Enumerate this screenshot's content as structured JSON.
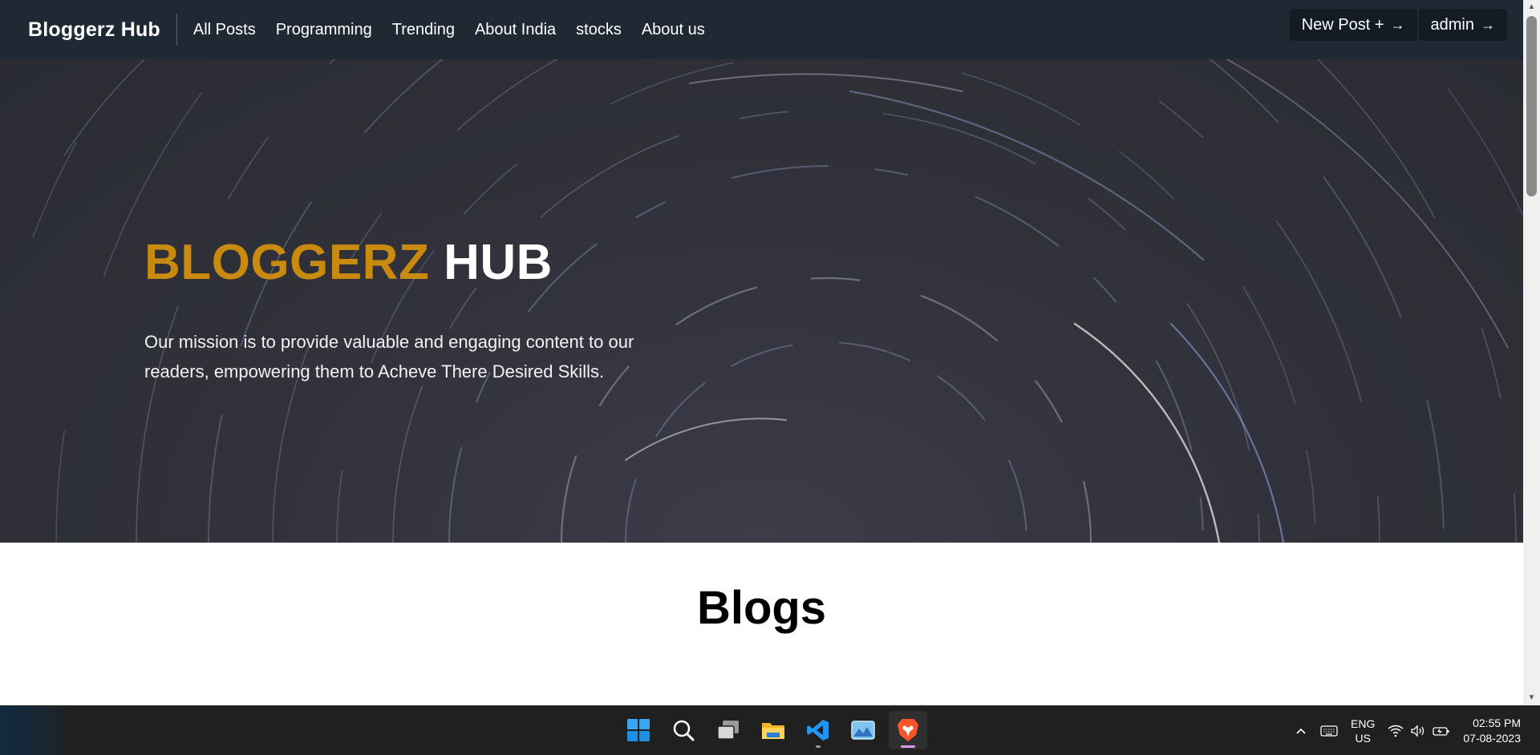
{
  "navbar": {
    "brand": "Bloggerz Hub",
    "links": [
      "All Posts",
      "Programming",
      "Trending",
      "About India",
      "stocks",
      "About us"
    ],
    "new_post_label": "New Post +",
    "admin_label": "admin",
    "arrow": "→",
    "background_color": "#1f2933"
  },
  "hero": {
    "title_part1": "BLOGGERZ",
    "title_part2": "HUB",
    "title_accent_color": "#c98a10",
    "description": "Our mission is to provide valuable and engaging content to our readers, empowering them to Acheve There Desired Skills."
  },
  "main": {
    "blogs_heading": "Blogs"
  },
  "taskbar": {
    "apps": [
      "windows-start-icon",
      "search-icon",
      "task-view-icon",
      "file-explorer-icon",
      "vscode-icon",
      "photos-icon",
      "brave-browser-icon"
    ],
    "tray": {
      "lang_line1": "ENG",
      "lang_line2": "US",
      "time": "02:55 PM",
      "date": "07-08-2023"
    }
  }
}
